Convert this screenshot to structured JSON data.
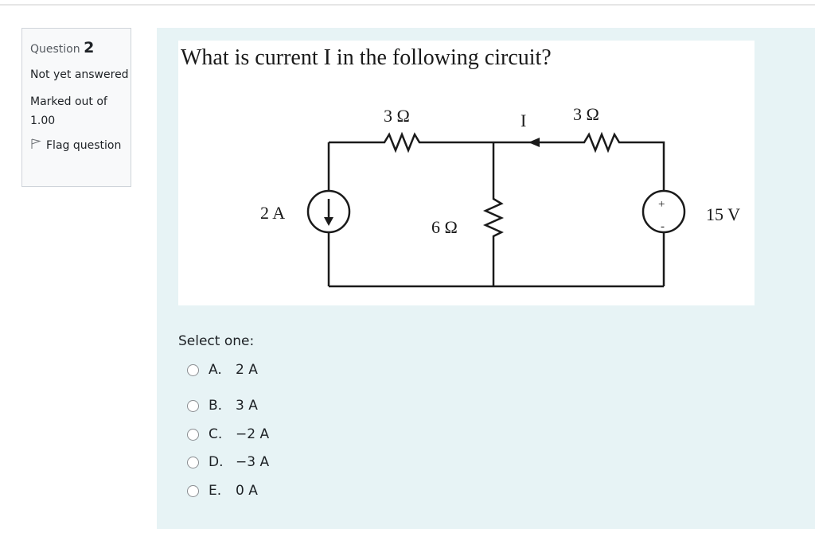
{
  "question_info": {
    "label": "Question",
    "number": "2",
    "state": "Not yet answered",
    "grade": "Marked out of 1.00",
    "flag_label": "Flag question",
    "flag_icon": "flag-icon"
  },
  "question": {
    "text": "What is current I in the following circuit?",
    "circuit": {
      "top_left_resistor": "3 Ω",
      "top_right_resistor": "3 Ω",
      "middle_resistor": "6 Ω",
      "current_source": "2 A",
      "voltage_source": "15 V",
      "current_label": "I",
      "plus_sign": "+",
      "minus_sign": "-"
    }
  },
  "prompt": "Select one:",
  "options": [
    {
      "letter": "A.",
      "text": "2 A",
      "selected": false
    },
    {
      "letter": "B.",
      "text": "3 A",
      "selected": false
    },
    {
      "letter": "C.",
      "text": "−2 A",
      "selected": false
    },
    {
      "letter": "D.",
      "text": "−3 A",
      "selected": false
    },
    {
      "letter": "E.",
      "text": "0 A",
      "selected": false
    }
  ]
}
